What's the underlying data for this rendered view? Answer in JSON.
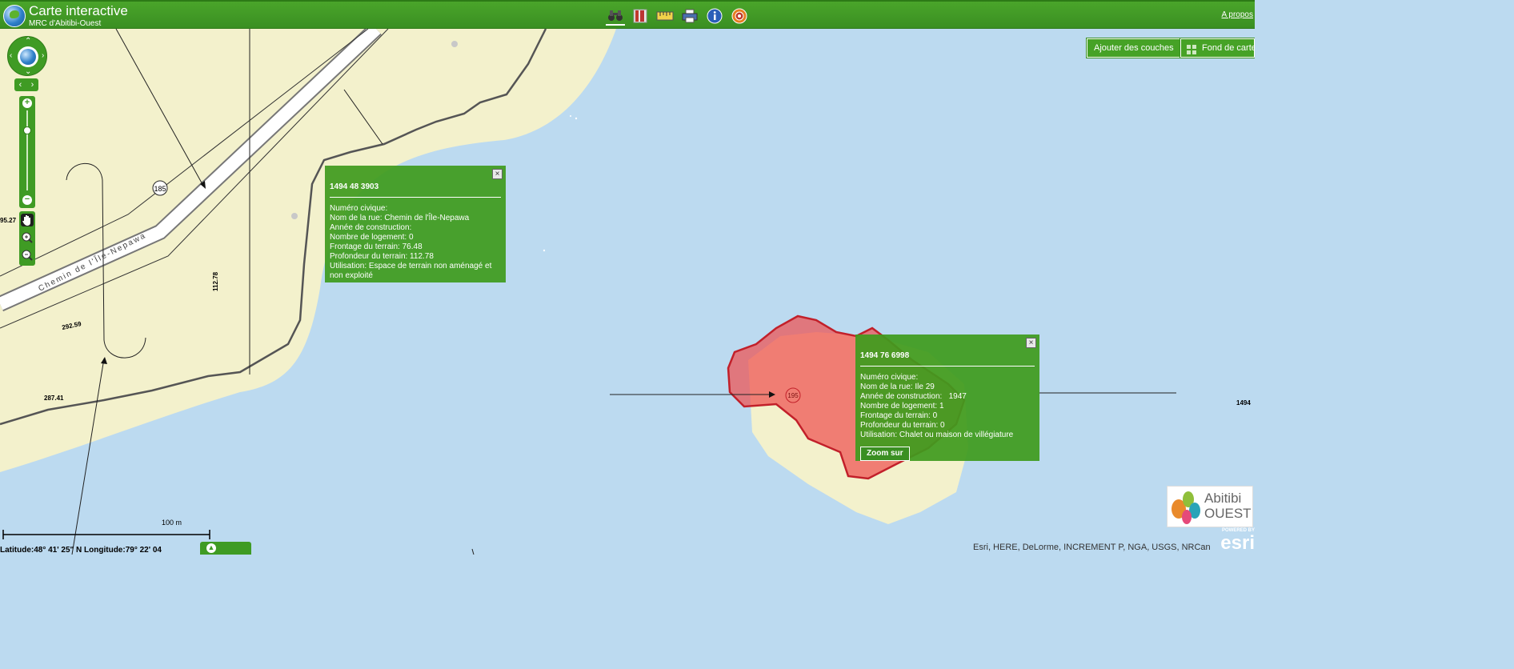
{
  "header": {
    "title": "Carte interactive",
    "subtitle": "MRC d'Abitibi-Ouest",
    "apropos_label": "A propos",
    "tools": [
      "binoculars-icon",
      "bookmarks-icon",
      "measure-icon",
      "print-icon",
      "info-icon",
      "target-icon"
    ]
  },
  "map_buttons": {
    "add_layers": "Ajouter des couches",
    "basemap": "Fond de carte"
  },
  "map_labels": {
    "road_name": "Chemin de l'Île-Nepawa",
    "route_185": "185",
    "route_195": "195",
    "dim_112": "112.78",
    "dim_292": "292.59",
    "dim_287": "287.41",
    "dim_95": "95.27",
    "dim_1494": "1494",
    "scale_label": "100 m"
  },
  "popup1": {
    "title": "1494 48 3903",
    "lines": [
      "Numéro civique:",
      "Nom de la rue: Chemin de l'Île-Nepawa",
      "Année de construction:",
      "Nombre de logement: 0",
      "Frontage du terrain: 76.48",
      "Profondeur du terrain: 112.78",
      "Utilisation: Espace de terrain non aménagé et non exploité"
    ],
    "close": "×"
  },
  "popup2": {
    "title": "1494 76 6998",
    "lines": [
      "Numéro civique:",
      "Nom de la rue: Ile 29",
      "Année de construction:   1947",
      "Nombre de logement: 1",
      "Frontage du terrain: 0",
      "Profondeur du terrain: 0",
      "Utilisation: Chalet ou maison de villégiature"
    ],
    "zoom_label": "Zoom sur",
    "close": "×"
  },
  "footer": {
    "coords": "Latitude:48° 41' 25\" N Longitude:79° 22' 04",
    "attribution": "Esri, HERE, DeLorme, INCREMENT P, NGA, USGS, NRCan",
    "powered_by": "POWERED BY",
    "esri": "esri",
    "brand_line1": "Abitibi",
    "brand_line2": "OUEST"
  },
  "colors": {
    "water": "#bcdaf0",
    "land": "#f3f1cc",
    "accent_green": "#46a226",
    "parcel_red": "#ee5a5a"
  }
}
